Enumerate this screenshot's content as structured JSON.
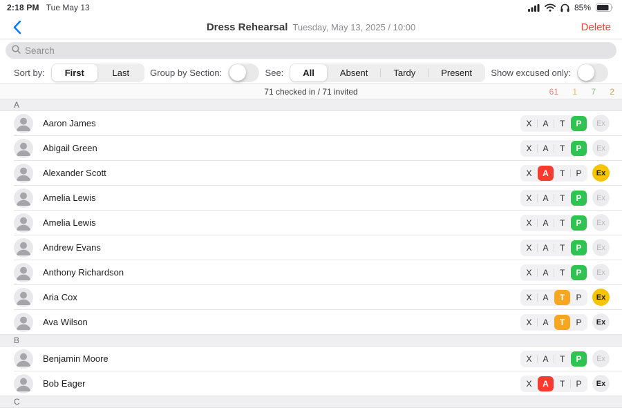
{
  "status_bar": {
    "time": "2:18 PM",
    "date": "Tue May 13",
    "battery_percent": "85%",
    "icons": [
      "cellular-signal-icon",
      "wifi-icon",
      "headphones-icon",
      "battery-icon"
    ]
  },
  "nav": {
    "back_icon": "chevron-left-icon",
    "title": "Dress Rehearsal",
    "subtitle": "Tuesday, May 13, 2025 / 10:00",
    "delete_label": "Delete"
  },
  "search": {
    "icon": "magnifier-icon",
    "placeholder": "Search"
  },
  "filters": {
    "sort_by_label": "Sort by:",
    "sort_options": [
      "First",
      "Last"
    ],
    "sort_selected": "First",
    "group_by_label": "Group by Section:",
    "group_by_on": false,
    "see_label": "See:",
    "see_options": [
      "All",
      "Absent",
      "Tardy",
      "Present"
    ],
    "see_selected": "All",
    "show_excused_label": "Show excused only:",
    "show_excused_on": false
  },
  "summary": {
    "checked_in_text": "71 checked in / 71 invited",
    "counts": [
      {
        "value": "61",
        "color": "#e5847e"
      },
      {
        "value": "1",
        "color": "#ecb25f"
      },
      {
        "value": "7",
        "color": "#82c690"
      },
      {
        "value": "2",
        "color": "#c7a857"
      }
    ]
  },
  "statuses": {
    "options": [
      "X",
      "A",
      "T",
      "P"
    ],
    "excused_label": "Ex",
    "colors": {
      "A": "#f93b2f",
      "T": "#f6a61f",
      "P": "#2fc351",
      "X": "#5a5a5e"
    },
    "excused_color": "#f6c500"
  },
  "sections": [
    {
      "letter": "A",
      "rows": [
        {
          "name": "Aaron James",
          "status": "P",
          "excused": "disabled"
        },
        {
          "name": "Abigail Green",
          "status": "P",
          "excused": "disabled"
        },
        {
          "name": "Alexander Scott",
          "status": "A",
          "excused": "excused"
        },
        {
          "name": "Amelia Lewis",
          "status": "P",
          "excused": "disabled"
        },
        {
          "name": "Amelia Lewis",
          "status": "P",
          "excused": "disabled"
        },
        {
          "name": "Andrew Evans",
          "status": "P",
          "excused": "disabled"
        },
        {
          "name": "Anthony Richardson",
          "status": "P",
          "excused": "disabled"
        },
        {
          "name": "Aria Cox",
          "status": "T",
          "excused": "excused"
        },
        {
          "name": "Ava Wilson",
          "status": "T",
          "excused": "enabled"
        }
      ]
    },
    {
      "letter": "B",
      "rows": [
        {
          "name": "Benjamin Moore",
          "status": "P",
          "excused": "disabled"
        },
        {
          "name": "Bob Eager",
          "status": "A",
          "excused": "enabled"
        }
      ]
    },
    {
      "letter": "C",
      "rows": []
    }
  ]
}
